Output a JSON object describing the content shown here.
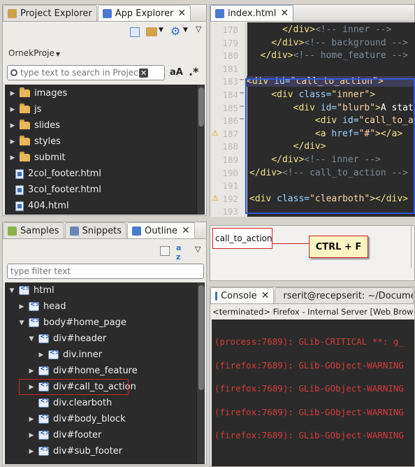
{
  "left_top": {
    "tabs": [
      {
        "label": "Project Explorer",
        "active": false
      },
      {
        "label": "App Explorer",
        "active": true
      }
    ],
    "project_name": "OrnekProje",
    "search_placeholder": "type text to search in Project",
    "search_btn": "aA",
    "regex_btn": ".*",
    "tree": [
      {
        "type": "folder",
        "label": "images"
      },
      {
        "type": "folder",
        "label": "js"
      },
      {
        "type": "folder",
        "label": "slides"
      },
      {
        "type": "folder",
        "label": "styles"
      },
      {
        "type": "folder",
        "label": "submit"
      },
      {
        "type": "file",
        "label": "2col_footer.html"
      },
      {
        "type": "file",
        "label": "3col_footer.html"
      },
      {
        "type": "file",
        "label": "404.html"
      }
    ]
  },
  "left_bottom": {
    "tabs": [
      {
        "label": "Samples",
        "active": false
      },
      {
        "label": "Snippets",
        "active": false
      },
      {
        "label": "Outline",
        "active": true
      }
    ],
    "filter_placeholder": "type filter text",
    "outline": [
      {
        "label": "html",
        "arrow": "down",
        "level": 0
      },
      {
        "label": "head",
        "arrow": "right",
        "level": 1
      },
      {
        "label": "body#home_page",
        "arrow": "down",
        "level": 1
      },
      {
        "label": "div#header",
        "arrow": "down",
        "level": 2
      },
      {
        "label": "div.inner",
        "arrow": "right",
        "level": 3
      },
      {
        "label": "div#home_feature",
        "arrow": "right",
        "level": 2
      },
      {
        "label": "div#call_to_action",
        "arrow": "right",
        "level": 2,
        "highlight": true
      },
      {
        "label": "div.clearboth",
        "arrow": "",
        "level": 2
      },
      {
        "label": "div#body_block",
        "arrow": "right",
        "level": 2
      },
      {
        "label": "div#footer",
        "arrow": "right",
        "level": 2
      },
      {
        "label": "div#sub_footer",
        "arrow": "right",
        "level": 2
      }
    ]
  },
  "editor": {
    "tab": "index.html",
    "lines": [
      {
        "n": "178",
        "parts": [
          [
            "sp",
            "      "
          ],
          [
            "tag",
            "</div>"
          ],
          [
            "cmt",
            "<!-- inner -->"
          ]
        ]
      },
      {
        "n": "179",
        "parts": [
          [
            "sp",
            "    "
          ],
          [
            "tag",
            "</div>"
          ],
          [
            "cmt",
            "<!-- background -->"
          ]
        ]
      },
      {
        "n": "180",
        "parts": [
          [
            "sp",
            "  "
          ],
          [
            "tag",
            "</div>"
          ],
          [
            "cmt",
            "<!-- home_feature -->"
          ]
        ]
      },
      {
        "n": "181",
        "parts": []
      },
      {
        "n": "183",
        "parts": [
          [
            "tag",
            "<div "
          ],
          [
            "attr",
            "id="
          ],
          [
            "val",
            "\"call_to_action\""
          ],
          [
            "tag",
            ">"
          ]
        ]
      },
      {
        "n": "184",
        "parts": [
          [
            "sp",
            "    "
          ],
          [
            "tag",
            "<div "
          ],
          [
            "attr",
            "class="
          ],
          [
            "val",
            "\"inner\""
          ],
          [
            "tag",
            ">"
          ]
        ]
      },
      {
        "n": "185",
        "parts": [
          [
            "sp",
            "        "
          ],
          [
            "tag",
            "<div "
          ],
          [
            "attr",
            "id="
          ],
          [
            "val",
            "\"blurb\""
          ],
          [
            "tag",
            ">"
          ],
          [
            "txt",
            "A stat"
          ]
        ]
      },
      {
        "n": "186",
        "parts": [
          [
            "sp",
            "            "
          ],
          [
            "tag",
            "<div "
          ],
          [
            "attr",
            "id="
          ],
          [
            "val",
            "\"call_to_a"
          ]
        ]
      },
      {
        "n": "187",
        "parts": [
          [
            "sp",
            "            "
          ],
          [
            "tag",
            "<a "
          ],
          [
            "attr",
            "href="
          ],
          [
            "val",
            "\"#\""
          ],
          [
            "tag",
            "></a>"
          ]
        ]
      },
      {
        "n": "188",
        "parts": [
          [
            "sp",
            "        "
          ],
          [
            "tag",
            "</div>"
          ]
        ]
      },
      {
        "n": "189",
        "parts": [
          [
            "sp",
            "    "
          ],
          [
            "tag",
            "</div>"
          ],
          [
            "cmt",
            "<!-- inner -->"
          ]
        ]
      },
      {
        "n": "190",
        "parts": [
          [
            "tag",
            "</div>"
          ],
          [
            "cmt",
            "<!-- call_to_action -->"
          ]
        ]
      },
      {
        "n": "191",
        "parts": []
      },
      {
        "n": "192",
        "parts": [
          [
            "tag",
            "<div "
          ],
          [
            "attr",
            "class="
          ],
          [
            "val",
            "\"clearboth\""
          ],
          [
            "tag",
            "></div>"
          ]
        ]
      },
      {
        "n": "193",
        "parts": []
      }
    ]
  },
  "find": {
    "value": "call_to_action",
    "callout": "CTRL + F"
  },
  "console": {
    "tabs": [
      {
        "label": "Console",
        "active": true
      },
      {
        "label": "rserit@recepserit: ~/Docume",
        "active": false
      }
    ],
    "status": "<terminated> Firefox - Internal Server [Web Brow",
    "lines": [
      "(process:7689): GLib-CRITICAL **: g_",
      "(firefox:7689): GLib-GObject-WARNING",
      "(firefox:7689): GLib-GObject-WARNING",
      "(firefox:7689): GLib-GObject-WARNING",
      "(firefox:7689): GLib-GObject-WARNING"
    ]
  },
  "colors": {
    "editor_bg": "#2b2b2b",
    "highlight_box": "#2f5bd8",
    "callout_border": "#cc2222",
    "console_text": "#d43a3a",
    "callout_bg": "#fff4c4"
  }
}
